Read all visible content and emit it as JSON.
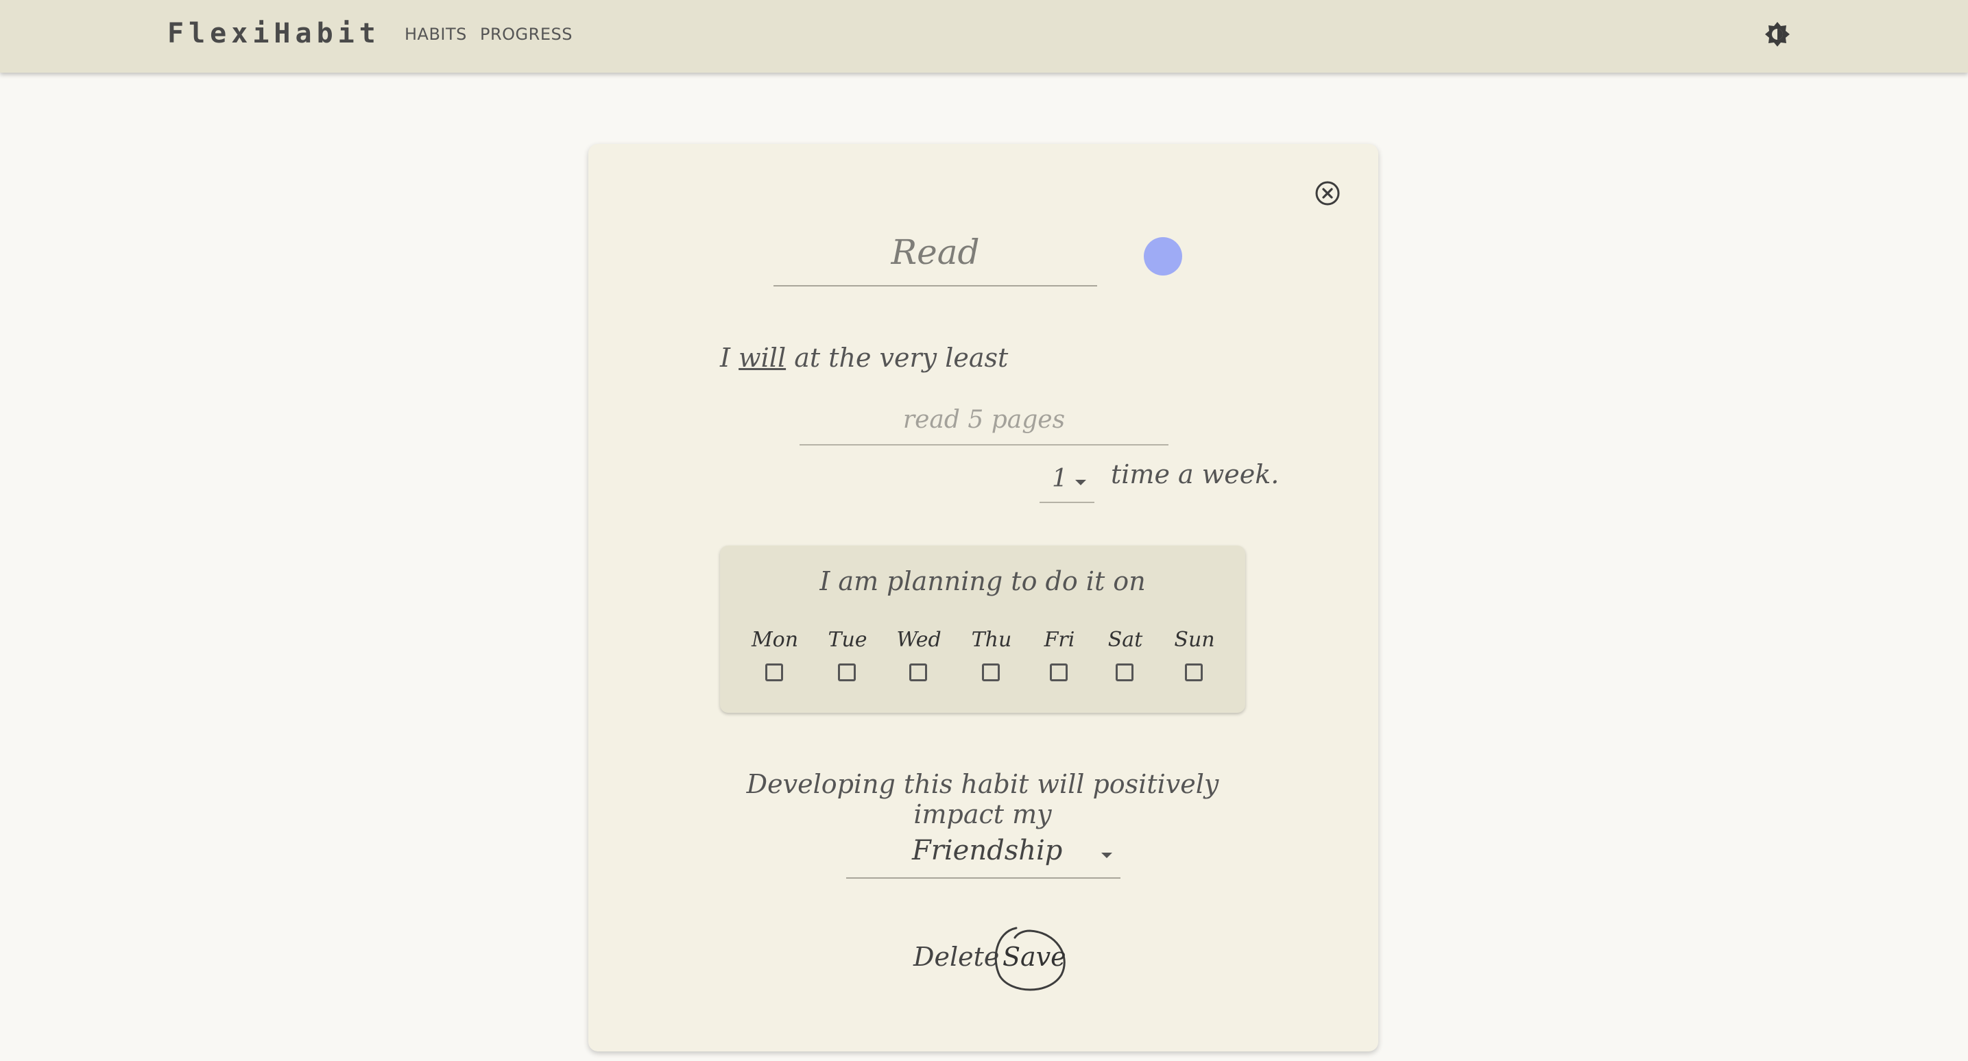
{
  "app": {
    "brand": "FlexiHabit",
    "nav": [
      {
        "label": "HABITS"
      },
      {
        "label": "PROGRESS"
      }
    ],
    "theme_toggle_icon": "brightness-icon"
  },
  "habit_form": {
    "name_placeholder": "Read",
    "color": "#9eabf5",
    "commitment_prefix": "I",
    "commitment_word": "will",
    "commitment_suffix": "at the very least",
    "action_placeholder": "read 5 pages",
    "frequency_value": "1",
    "frequency_suffix": "time a week.",
    "plan_title": "I am planning to do it on",
    "days": [
      {
        "label": "Mon",
        "checked": false
      },
      {
        "label": "Tue",
        "checked": false
      },
      {
        "label": "Wed",
        "checked": false
      },
      {
        "label": "Thu",
        "checked": false
      },
      {
        "label": "Fri",
        "checked": false
      },
      {
        "label": "Sat",
        "checked": false
      },
      {
        "label": "Sun",
        "checked": false
      }
    ],
    "impact_text": "Developing this habit will positively impact my",
    "impact_value": "Friendship",
    "delete_label": "Delete",
    "save_label": "Save",
    "close_icon": "close-circle-icon"
  }
}
